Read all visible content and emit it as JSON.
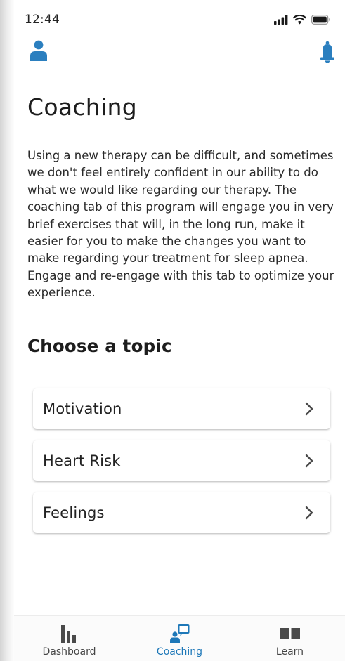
{
  "status_bar": {
    "time": "12:44",
    "icons": [
      "cellular-signal-icon",
      "wifi-icon",
      "battery-icon"
    ]
  },
  "top_bar": {
    "icons": [
      "profile-icon",
      "bell-icon"
    ],
    "accent_color": "#2b7fbf"
  },
  "main": {
    "title": "Coaching",
    "intro": "Using a new therapy can be difficult, and sometimes we don't feel entirely confident in our ability to do what we would like regarding our therapy. The coaching tab of this program will engage you in very brief exercises that will, in the long run, make it easier for you to make the changes you want to make regarding your treatment for sleep apnea. Engage and re-engage with this tab to optimize your experience.",
    "section_title": "Choose a topic",
    "topics": [
      {
        "label": "Motivation",
        "icon": "chevron-right-icon"
      },
      {
        "label": "Heart Risk",
        "icon": "chevron-right-icon"
      },
      {
        "label": "Feelings",
        "icon": "chevron-right-icon"
      }
    ]
  },
  "tab_bar": {
    "tabs": [
      {
        "label": "Dashboard",
        "icon": "bar-chart-icon",
        "active": false
      },
      {
        "label": "Coaching",
        "icon": "coaching-chat-icon",
        "active": true
      },
      {
        "label": "Learn",
        "icon": "book-icon",
        "active": false
      }
    ],
    "active_color": "#1e78b8",
    "inactive_color": "#444444"
  }
}
